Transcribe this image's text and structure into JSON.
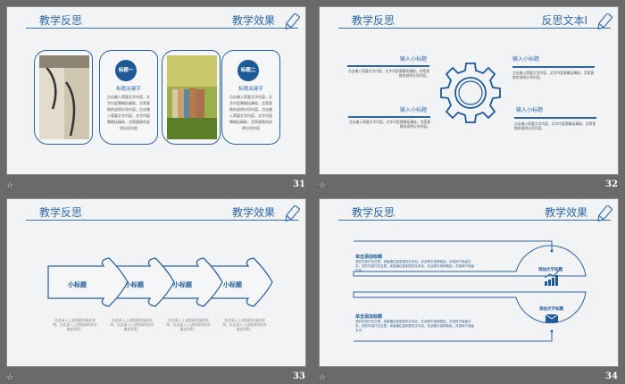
{
  "accent": "#2f6aa8",
  "slides": [
    {
      "number": "31",
      "title_left": "教学反思",
      "title_right": "教学效果",
      "cards": [
        {
          "badge": "标题一",
          "subtitle": "标题关键字",
          "body": "点击输入简要文字内容，文字内容需概括精炼，言简意赅的说明分项内容。点击输入简要文字内容，文字内容需概括精炼，言简意赅的说明分项内容"
        },
        {
          "badge": "标题二",
          "subtitle": "标题关键字",
          "body": "点击输入简要文字内容，文字内容需概括精炼，言简意赅的说明分项内容。点击输入简要文字内容，文字内容需概括精炼，言简意赅的说明分项内容"
        }
      ]
    },
    {
      "number": "32",
      "title_left": "教学反思",
      "title_right": "反思文本I",
      "items": [
        {
          "title": "输入小标题",
          "body": "点击输入简要文字内容，文字内容需概括精炼，言简意赅的说明分项内容。"
        },
        {
          "title": "输入小标题",
          "body": "点击输入简要文字内容，文字内容需概括精炼，言简意赅的说明分项内容。"
        },
        {
          "title": "输入小标题",
          "body": "点击输入简要文字内容，文字内容需概括精炼，言简意赅的说明分项内容。"
        },
        {
          "title": "输入小标题",
          "body": "点击输入简要文字内容，文字内容需概括精炼，言简意赅的说明分项内容。"
        }
      ]
    },
    {
      "number": "33",
      "title_left": "教学反思",
      "title_right": "教学效果",
      "arrows": [
        {
          "label": "小标题",
          "desc": "在此录入上述图表的描述说明，在此录入上述图表的综合描述说明。"
        },
        {
          "label": "小标题",
          "desc": "在此录入上述图表的描述说明，在此录入上述图表的综合描述说明。"
        },
        {
          "label": "小标题",
          "desc": "在此录入上述图表的描述说明，在此录入上述图表的综合描述说明。"
        },
        {
          "label": "小标题",
          "desc": "在此录入上述图表的描述说明，在此录入上述图表的综合描述说明。"
        }
      ]
    },
    {
      "number": "34",
      "title_left": "教学反思",
      "title_right": "教学效果",
      "blocks": [
        {
          "heading": "单击添加标题",
          "body": "您的内容打在这里，或者通过复制您的文本后，在此框中选择粘贴，并选择只保留文字。您的内容打在这里，或者通过复制您的文本后，在此框中选择粘贴，并选择只保留文字。",
          "circle_label": "添加文字标题",
          "icon": "chart-icon"
        },
        {
          "heading": "单击添加标题",
          "body": "您的内容打在这里，或者通过复制您的文本后，在此框中选择粘贴，并选择只保留文字。您的内容打在这里，或者通过复制您的文本后，在此框中选择粘贴，并选择只保留文字。",
          "circle_label": "添加文字标题",
          "icon": "envelope-icon"
        }
      ]
    }
  ]
}
